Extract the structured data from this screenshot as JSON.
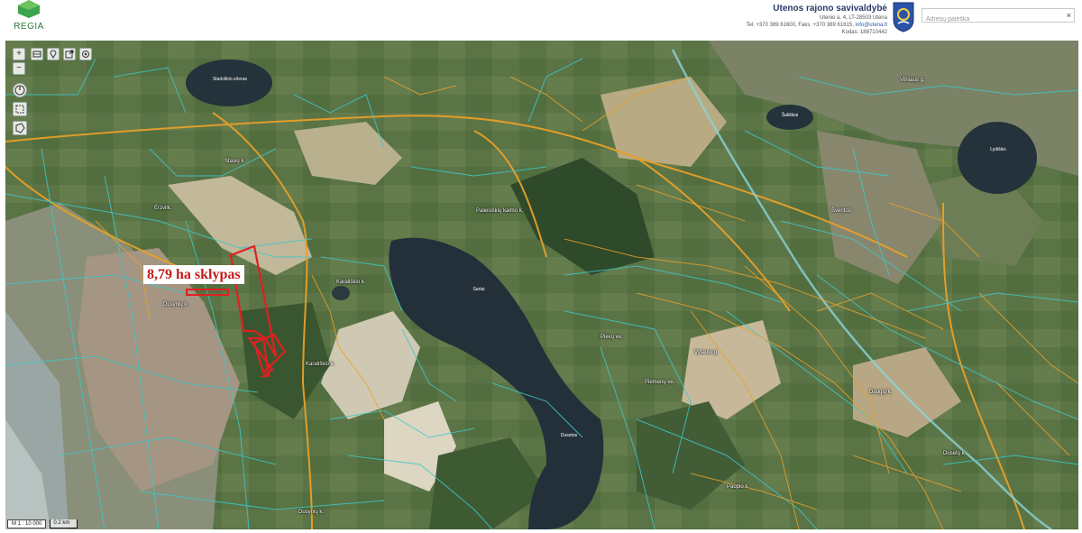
{
  "app": {
    "logo_text": "REGIA"
  },
  "municipality": {
    "name": "Utenos rajono savivaldybė",
    "address": "Utenio a. 4, LT-28503 Utena",
    "contacts": "Tel. +370 389 61600, Faks. +370 389 61615,",
    "email": "info@utena.lt",
    "code": "Kodas: 188710442"
  },
  "search": {
    "placeholder": "Adresų paieška",
    "value": "",
    "clear_icon": "×"
  },
  "toolbar": {
    "zoom_in": "+",
    "zoom_out": "−",
    "icons": [
      "map-layers-icon",
      "location-pin-icon",
      "export-icon",
      "target-icon",
      "compass-icon",
      "measure-icon",
      "polygon-select-icon"
    ]
  },
  "map": {
    "plot_label": "8,79 ha sklypas",
    "labels": {
      "starkis_lake": "Starkiškio ežeras",
      "stasiu_k": "Stasių k.",
      "erzvilkas": "Ėrzvilk.",
      "dusyniu_k1": "Dusynių k.",
      "karaliskio_k1": "Karališkio k.",
      "karaliskio_k2": "Karališkio k.",
      "dusyniu_k2": "Dusynių k.",
      "pakalniskiu": "Paliesiškių kaimo k.",
      "dusetos_lake": "Sartai",
      "dusetos_lake2": "Dusetos",
      "pievu_ve": "Pievų ve.",
      "vytauto_g": "Vytauto g.",
      "piemeni_ve": "Piemenų ve.",
      "paupio": "Paupio k.",
      "lydiskis": "Lydiškis",
      "vilniaus": "Vilniaus g.",
      "saliskiai": "Šališkiai",
      "daugiu": "Daugių k.",
      "dusetu_k": "Dusetų k.",
      "sventos": "Šventos"
    },
    "scale_ratio": "M 1 : 10 000",
    "scale_distance": "0.2 km"
  },
  "colors": {
    "parcel_cyan": "#3ec8c8",
    "parcel_orange": "#e8a028",
    "plot_red": "#e02020",
    "water": "#23303a",
    "header_text": "#2a3a6a"
  }
}
